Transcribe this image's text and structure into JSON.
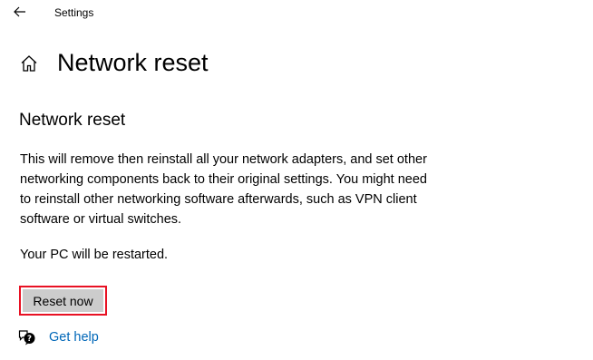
{
  "window": {
    "title": "Settings"
  },
  "icons": {
    "back": "back-arrow-icon",
    "home": "home-icon",
    "help": "help-chat-icon"
  },
  "page": {
    "title": "Network reset",
    "section_heading": "Network reset",
    "description": "This will remove then reinstall all your network adapters, and set other networking components back to their original settings. You might need to reinstall other networking software afterwards, such as VPN client software or virtual switches.",
    "restart_note": "Your PC will be restarted.",
    "reset_button_label": "Reset now",
    "help_link_label": "Get help"
  },
  "colors": {
    "highlight_border": "#e81123",
    "button_fill": "#cccccc",
    "link": "#0067b8"
  }
}
